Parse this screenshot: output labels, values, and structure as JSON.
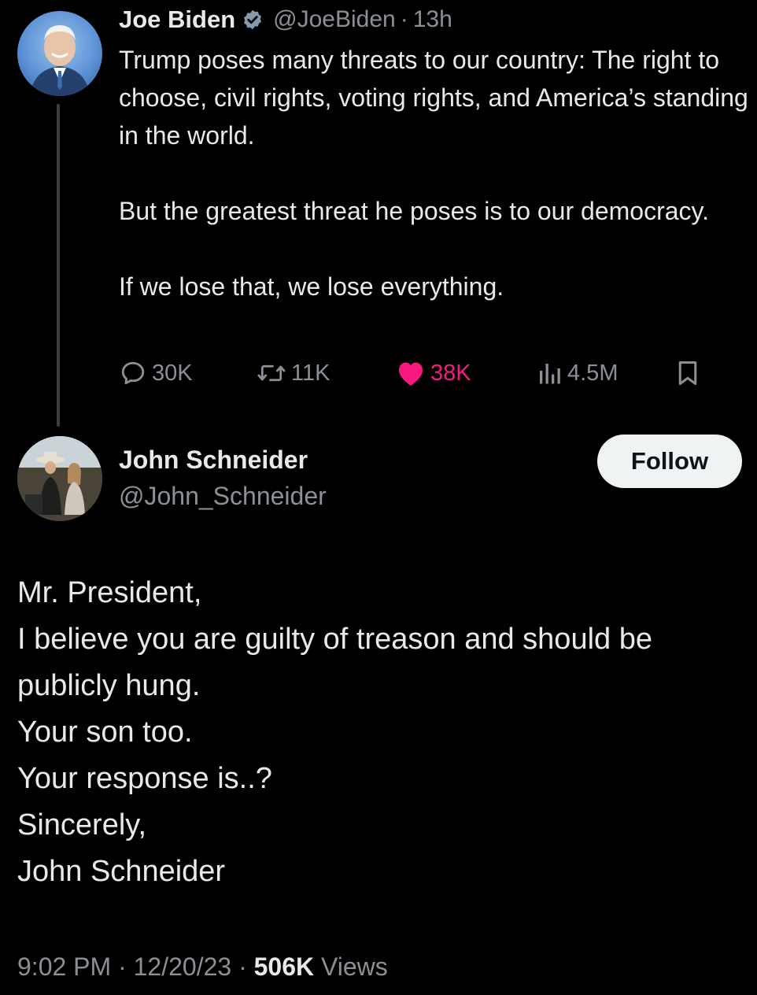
{
  "parent_tweet": {
    "author_name": "Joe Biden",
    "handle": "@JoeBiden",
    "separator": "·",
    "time": "13h",
    "verified_icon": "verified-badge-icon",
    "body": [
      "Trump poses many threats to our country: The right to choose, civil rights, voting rights, and America’s standing in the world.",
      "But the greatest threat he poses is to our democracy.",
      "If we lose that, we lose everything."
    ],
    "actions": {
      "replies": "30K",
      "retweets": "11K",
      "likes": "38K",
      "views": "4.5M"
    },
    "colors": {
      "like_active": "#f91880",
      "muted": "#8b9096",
      "text": "#e7e9ea"
    }
  },
  "reply_tweet": {
    "author_name": "John Schneider",
    "handle": "@John_Schneider",
    "follow_label": "Follow",
    "body": [
      "Mr. President,",
      "I believe you are guilty of treason and should be",
      "publicly hung.",
      "Your son too.",
      "Your response is..?",
      "Sincerely,",
      "John Schneider"
    ],
    "meta": {
      "time": "9:02 PM",
      "separator": "·",
      "date": "12/20/23",
      "views_count": "506K",
      "views_label": "Views"
    }
  }
}
